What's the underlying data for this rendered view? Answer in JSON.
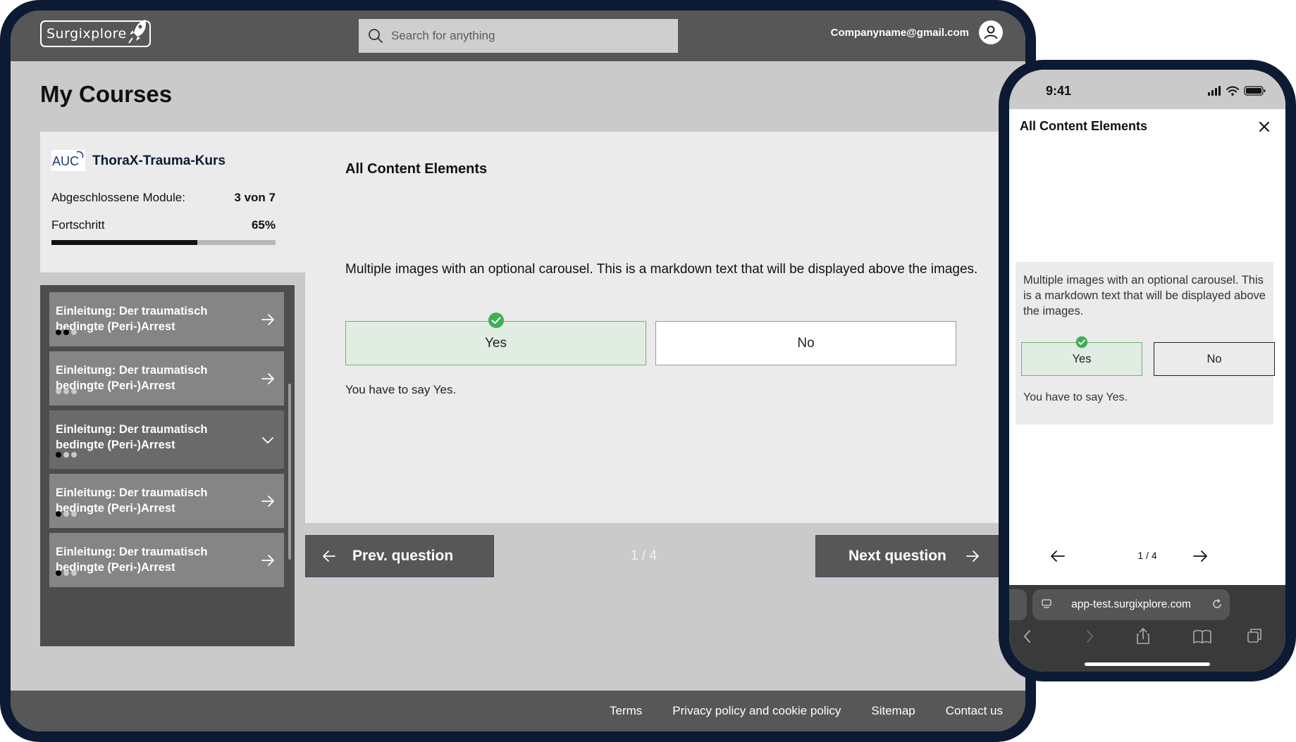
{
  "header": {
    "logo": "Surgixplore",
    "search_placeholder": "Search for anything",
    "account_email": "Companyname@gmail.com"
  },
  "page_title": "My Courses",
  "course": {
    "logo_text": "AUC",
    "name": "ThoraX-Trauma-Kurs",
    "modules_label": "Abgeschlossene Module:",
    "modules_value": "3 von 7",
    "progress_label": "Fortschritt",
    "progress_value": "65%",
    "progress_fraction": 0.65
  },
  "modules": [
    {
      "title": "Einleitung: Der traumatisch bedingte (Peri-)Arrest",
      "dots_done": 2,
      "dots_total": 3,
      "expanded": false
    },
    {
      "title": "Einleitung: Der traumatisch bedingte (Peri-)Arrest",
      "dots_done": 0,
      "dots_total": 3,
      "expanded": false
    },
    {
      "title": "Einleitung: Der traumatisch bedingte (Peri-)Arrest",
      "dots_done": 1,
      "dots_total": 3,
      "expanded": true
    },
    {
      "title": "Einleitung: Der traumatisch bedingte (Peri-)Arrest",
      "dots_done": 1,
      "dots_total": 3,
      "expanded": false
    },
    {
      "title": "Einleitung: Der traumatisch bedingte (Peri-)Arrest",
      "dots_done": 1,
      "dots_total": 3,
      "expanded": false
    }
  ],
  "content": {
    "title": "All Content Elements",
    "text": "Multiple images with an optional carousel. This is a markdown text that will be displayed above the images.",
    "option_yes": "Yes",
    "option_no": "No",
    "hint": "You have to say Yes."
  },
  "navigation": {
    "prev_label": "Prev. question",
    "next_label": "Next question",
    "counter": "1 / 4"
  },
  "footer": {
    "links": [
      "Terms",
      "Privacy policy and cookie policy",
      "Sitemap",
      "Contact us"
    ]
  },
  "mobile": {
    "time": "9:41",
    "title": "All Content Elements",
    "text": "Multiple images with an optional carousel. This is a markdown text that will be displayed above the images.",
    "option_yes": "Yes",
    "option_no": "No",
    "hint": "You have to say Yes.",
    "counter": "1 / 4",
    "url": "app-test.surgixplore.com"
  },
  "colors": {
    "navy_frame": "#0d1a33",
    "header_gray": "#575757",
    "success_green": "#3fae57",
    "selected_bg": "#e1ece2"
  }
}
